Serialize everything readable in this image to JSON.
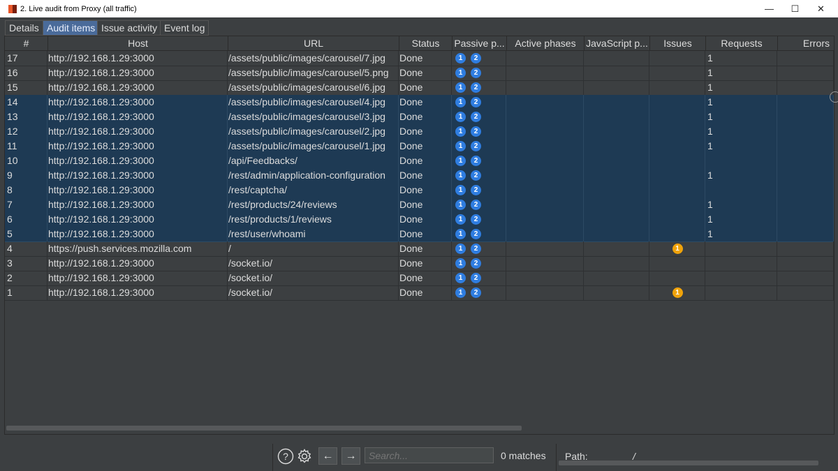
{
  "window": {
    "title": "2. Live audit from Proxy (all traffic)",
    "minimize_glyph": "—",
    "maximize_glyph": "☐",
    "close_glyph": "✕"
  },
  "tabs": [
    {
      "label": "Details",
      "active": false
    },
    {
      "label": "Audit items",
      "active": true
    },
    {
      "label": "Issue activity",
      "active": false
    },
    {
      "label": "Event log",
      "active": false
    }
  ],
  "table": {
    "columns": [
      "#",
      "Host",
      "URL",
      "Status",
      "Passive p...",
      "Active phases",
      "JavaScript p...",
      "Issues",
      "Requests",
      "Errors"
    ],
    "rows": [
      {
        "num": "17",
        "host": "http://192.168.1.29:3000",
        "url": "/assets/public/images/carousel/7.jpg",
        "status": "Done",
        "passive": [
          "1",
          "2"
        ],
        "issues": "",
        "requests": "1",
        "selected": false
      },
      {
        "num": "16",
        "host": "http://192.168.1.29:3000",
        "url": "/assets/public/images/carousel/5.png",
        "status": "Done",
        "passive": [
          "1",
          "2"
        ],
        "issues": "",
        "requests": "1",
        "selected": false
      },
      {
        "num": "15",
        "host": "http://192.168.1.29:3000",
        "url": "/assets/public/images/carousel/6.jpg",
        "status": "Done",
        "passive": [
          "1",
          "2"
        ],
        "issues": "",
        "requests": "1",
        "selected": false
      },
      {
        "num": "14",
        "host": "http://192.168.1.29:3000",
        "url": "/assets/public/images/carousel/4.jpg",
        "status": "Done",
        "passive": [
          "1",
          "2"
        ],
        "issues": "",
        "requests": "1",
        "selected": true
      },
      {
        "num": "13",
        "host": "http://192.168.1.29:3000",
        "url": "/assets/public/images/carousel/3.jpg",
        "status": "Done",
        "passive": [
          "1",
          "2"
        ],
        "issues": "",
        "requests": "1",
        "selected": true
      },
      {
        "num": "12",
        "host": "http://192.168.1.29:3000",
        "url": "/assets/public/images/carousel/2.jpg",
        "status": "Done",
        "passive": [
          "1",
          "2"
        ],
        "issues": "",
        "requests": "1",
        "selected": true
      },
      {
        "num": "11",
        "host": "http://192.168.1.29:3000",
        "url": "/assets/public/images/carousel/1.jpg",
        "status": "Done",
        "passive": [
          "1",
          "2"
        ],
        "issues": "",
        "requests": "1",
        "selected": true
      },
      {
        "num": "10",
        "host": "http://192.168.1.29:3000",
        "url": "/api/Feedbacks/",
        "status": "Done",
        "passive": [
          "1",
          "2"
        ],
        "issues": "",
        "requests": "",
        "selected": true
      },
      {
        "num": "9",
        "host": "http://192.168.1.29:3000",
        "url": "/rest/admin/application-configuration",
        "status": "Done",
        "passive": [
          "1",
          "2"
        ],
        "issues": "",
        "requests": "1",
        "selected": true
      },
      {
        "num": "8",
        "host": "http://192.168.1.29:3000",
        "url": "/rest/captcha/",
        "status": "Done",
        "passive": [
          "1",
          "2"
        ],
        "issues": "",
        "requests": "",
        "selected": true
      },
      {
        "num": "7",
        "host": "http://192.168.1.29:3000",
        "url": "/rest/products/24/reviews",
        "status": "Done",
        "passive": [
          "1",
          "2"
        ],
        "issues": "",
        "requests": "1",
        "selected": true
      },
      {
        "num": "6",
        "host": "http://192.168.1.29:3000",
        "url": "/rest/products/1/reviews",
        "status": "Done",
        "passive": [
          "1",
          "2"
        ],
        "issues": "",
        "requests": "1",
        "selected": true
      },
      {
        "num": "5",
        "host": "http://192.168.1.29:3000",
        "url": "/rest/user/whoami",
        "status": "Done",
        "passive": [
          "1",
          "2"
        ],
        "issues": "",
        "requests": "1",
        "selected": true
      },
      {
        "num": "4",
        "host": "https://push.services.mozilla.com",
        "url": "/",
        "status": "Done",
        "passive": [
          "1",
          "2"
        ],
        "issues": "1",
        "requests": "",
        "selected": false
      },
      {
        "num": "3",
        "host": "http://192.168.1.29:3000",
        "url": "/socket.io/",
        "status": "Done",
        "passive": [
          "1",
          "2"
        ],
        "issues": "",
        "requests": "",
        "selected": false
      },
      {
        "num": "2",
        "host": "http://192.168.1.29:3000",
        "url": "/socket.io/",
        "status": "Done",
        "passive": [
          "1",
          "2"
        ],
        "issues": "",
        "requests": "",
        "selected": false
      },
      {
        "num": "1",
        "host": "http://192.168.1.29:3000",
        "url": "/socket.io/",
        "status": "Done",
        "passive": [
          "1",
          "2"
        ],
        "issues": "1",
        "requests": "",
        "selected": false
      }
    ]
  },
  "bottom": {
    "help_glyph": "?",
    "settings_glyph": "⚙",
    "back_glyph": "←",
    "forward_glyph": "→",
    "search_placeholder": "Search...",
    "matches": "0 matches",
    "path_label": "Path:",
    "path_value": "/"
  },
  "colors": {
    "background": "#3c3f41",
    "selected_row": "#1e3a54",
    "active_tab": "#4a6b9a",
    "phase_badge": "#2f7de0",
    "issue_badge": "#f0a30a"
  }
}
